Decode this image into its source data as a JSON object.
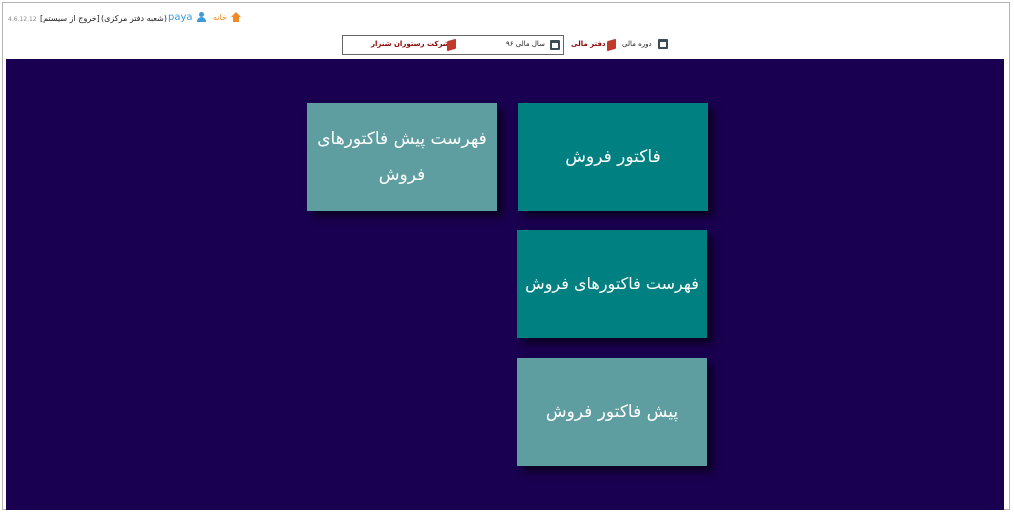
{
  "header": {
    "home_label": "خانه",
    "username": "paya",
    "branch_label": "(شعبه دفتر مرکزی)",
    "logout_label": "[خروج از سیستم]",
    "version": "4.6.12.12",
    "period_label": "دوره مالی",
    "ledger_label": "دفتر مالی",
    "fiscal_year": "سال مالی ۹۶",
    "company_name": "شرکت رستوران شنزار"
  },
  "tiles": {
    "sales_invoice": "فاکتور فروش",
    "proforma_list": "فهرست پیش فاکتورهای فروش",
    "sales_invoice_list": "فهرست فاکتورهای فروش",
    "proforma_invoice": "پیش فاکتور فروش"
  },
  "colors": {
    "background": "#1a0050",
    "tile_primary": "#008080",
    "tile_secondary": "#5f9ea0",
    "home_accent": "#f08a24",
    "user_accent": "#3a9bd8"
  }
}
